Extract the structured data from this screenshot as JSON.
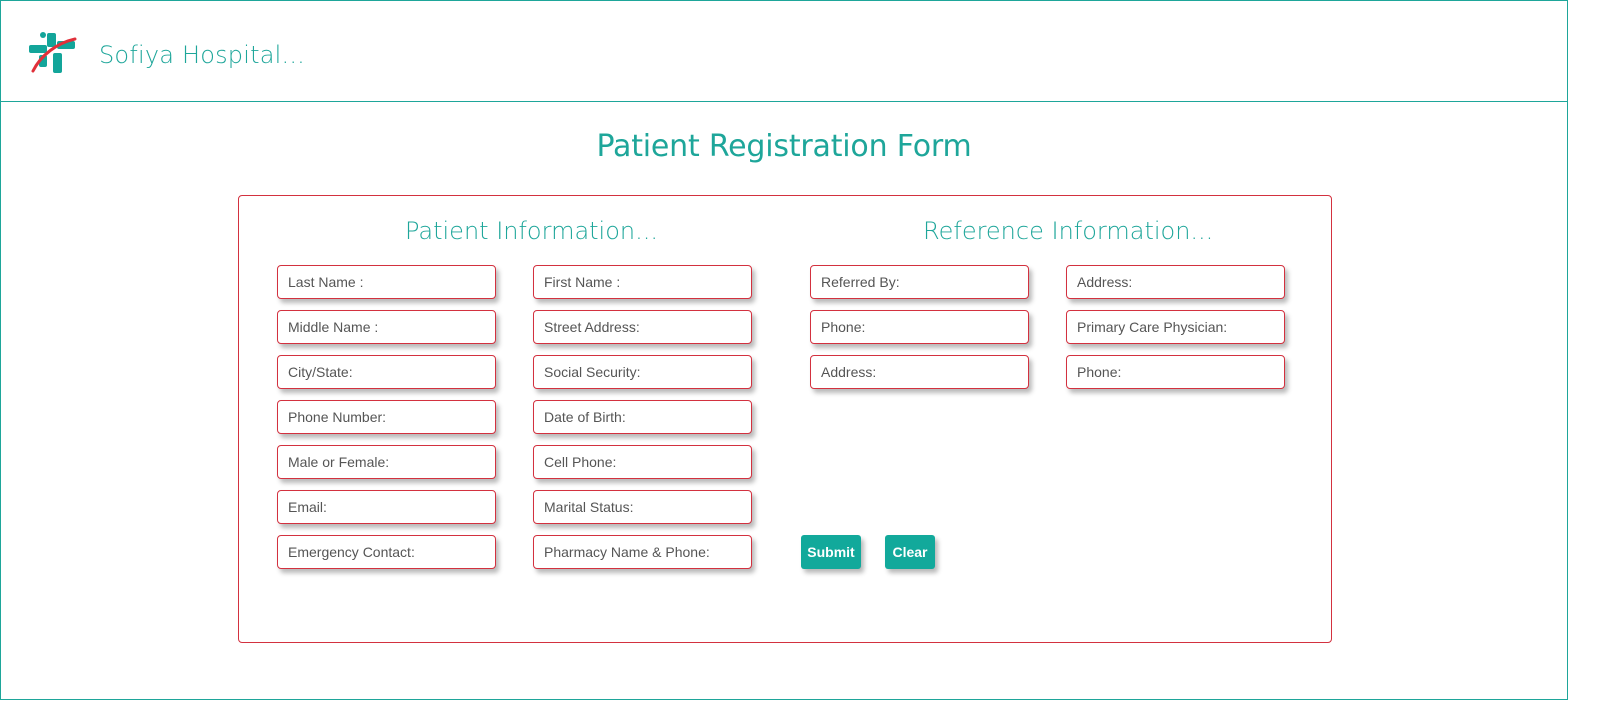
{
  "header": {
    "brand": "Sofiya Hospital..."
  },
  "page_title": "Patient Registration Form",
  "patient_section": {
    "title": "Patient Information...",
    "fields_col1": [
      "Last Name :",
      "Middle Name :",
      "City/State:",
      "Phone Number:",
      "Male or Female:",
      "Email:",
      "Emergency Contact:"
    ],
    "fields_col2": [
      "First Name :",
      "Street Address:",
      "Social Security:",
      "Date of Birth:",
      "Cell Phone:",
      "Marital Status:",
      "Pharmacy Name & Phone:"
    ]
  },
  "reference_section": {
    "title": "Reference Information...",
    "fields_col1": [
      "Referred By:",
      "Phone:",
      "Address:"
    ],
    "fields_col2": [
      "Address:",
      "Primary Care Physician:",
      "Phone:"
    ]
  },
  "buttons": {
    "submit": "Submit",
    "clear": "Clear"
  },
  "colors": {
    "accent": "#1ea69a",
    "button": "#12a99b",
    "field_border": "#d3313f",
    "logo_red": "#e0303a"
  },
  "icons": {
    "logo": "medical-cross-icon"
  }
}
